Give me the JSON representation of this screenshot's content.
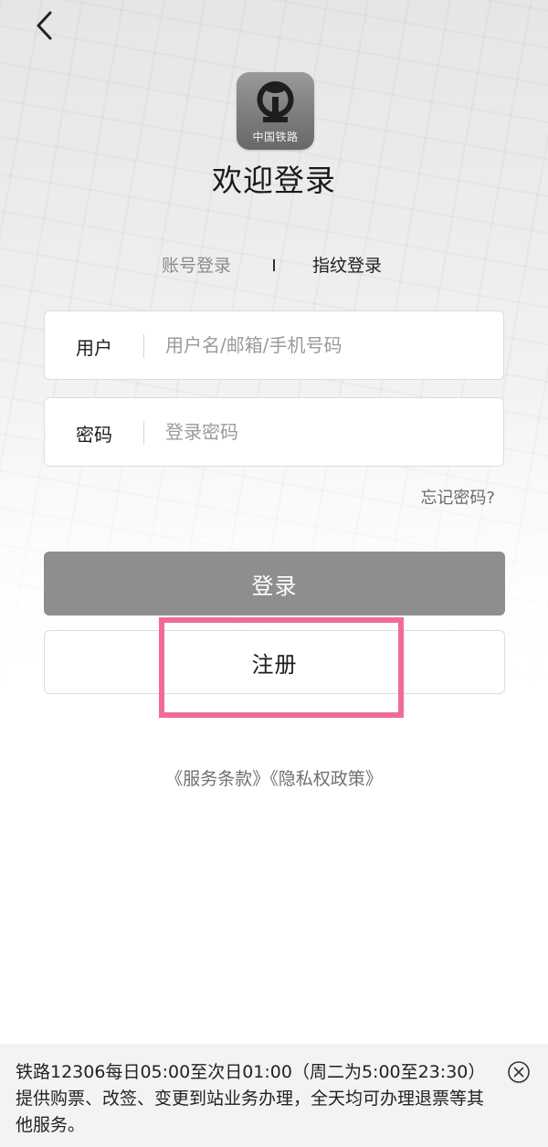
{
  "header": {
    "back_icon": "chevron-left-icon"
  },
  "logo": {
    "icon": "china-railway-emblem-icon",
    "caption": "中国铁路"
  },
  "page_title": "欢迎登录",
  "tabs": [
    {
      "label": "账号登录",
      "active": false
    },
    {
      "label": "指纹登录",
      "active": true
    }
  ],
  "form": {
    "user": {
      "label": "用户",
      "value": "",
      "placeholder": "用户名/邮箱/手机号码"
    },
    "password": {
      "label": "密码",
      "value": "",
      "placeholder": "登录密码"
    },
    "forgot_label": "忘记密码?"
  },
  "buttons": {
    "login_label": "登录",
    "register_label": "注册"
  },
  "links": {
    "terms": "《服务条款》",
    "privacy": "《隐私权政策》"
  },
  "notice": {
    "text": "铁路12306每日05:00至次日01:00（周二为5:00至23:30）提供购票、改签、变更到站业务办理，全天均可办理退票等其他服务。",
    "close_icon": "close-circle-icon"
  },
  "colors": {
    "primary_button": "#8e8e8e",
    "highlight_box": "#f06c95",
    "muted_text": "#8a8a8a",
    "notice_bg": "#f3f3f3"
  }
}
